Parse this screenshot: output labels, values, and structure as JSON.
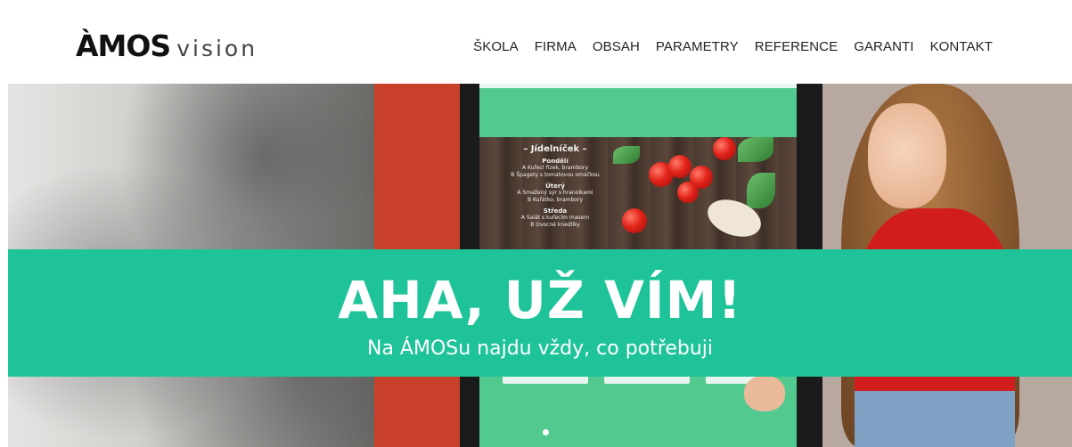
{
  "logo": {
    "main": "ÀMOS",
    "sub": "vision"
  },
  "nav": {
    "items": [
      {
        "label": "ŠKOLA"
      },
      {
        "label": "FIRMA"
      },
      {
        "label": "OBSAH"
      },
      {
        "label": "PARAMETRY"
      },
      {
        "label": "REFERENCE"
      },
      {
        "label": "GARANTI"
      },
      {
        "label": "KONTAKT"
      }
    ]
  },
  "hero": {
    "kiosk_menu": {
      "title": "– Jídelníček –",
      "days": [
        {
          "day": "Pondělí",
          "lines": [
            "A Kuřecí řízek, brambory",
            "B Špagety s tomatovou omáčkou"
          ]
        },
        {
          "day": "Úterý",
          "lines": [
            "A Smažený sýr s hranolkami",
            "B Kuřátko, brambory"
          ]
        },
        {
          "day": "Středa",
          "lines": [
            "A Salát s kuřecím masem",
            "B Ovocné knedlíky"
          ]
        }
      ]
    },
    "headline": "AHA, UŽ VÍM!",
    "subheadline": "Na ÁMOSu najdu vždy, co potřebuji"
  },
  "colors": {
    "accent": "#1fc39a",
    "text_dark": "#222222",
    "banner_text": "#ffffff"
  }
}
